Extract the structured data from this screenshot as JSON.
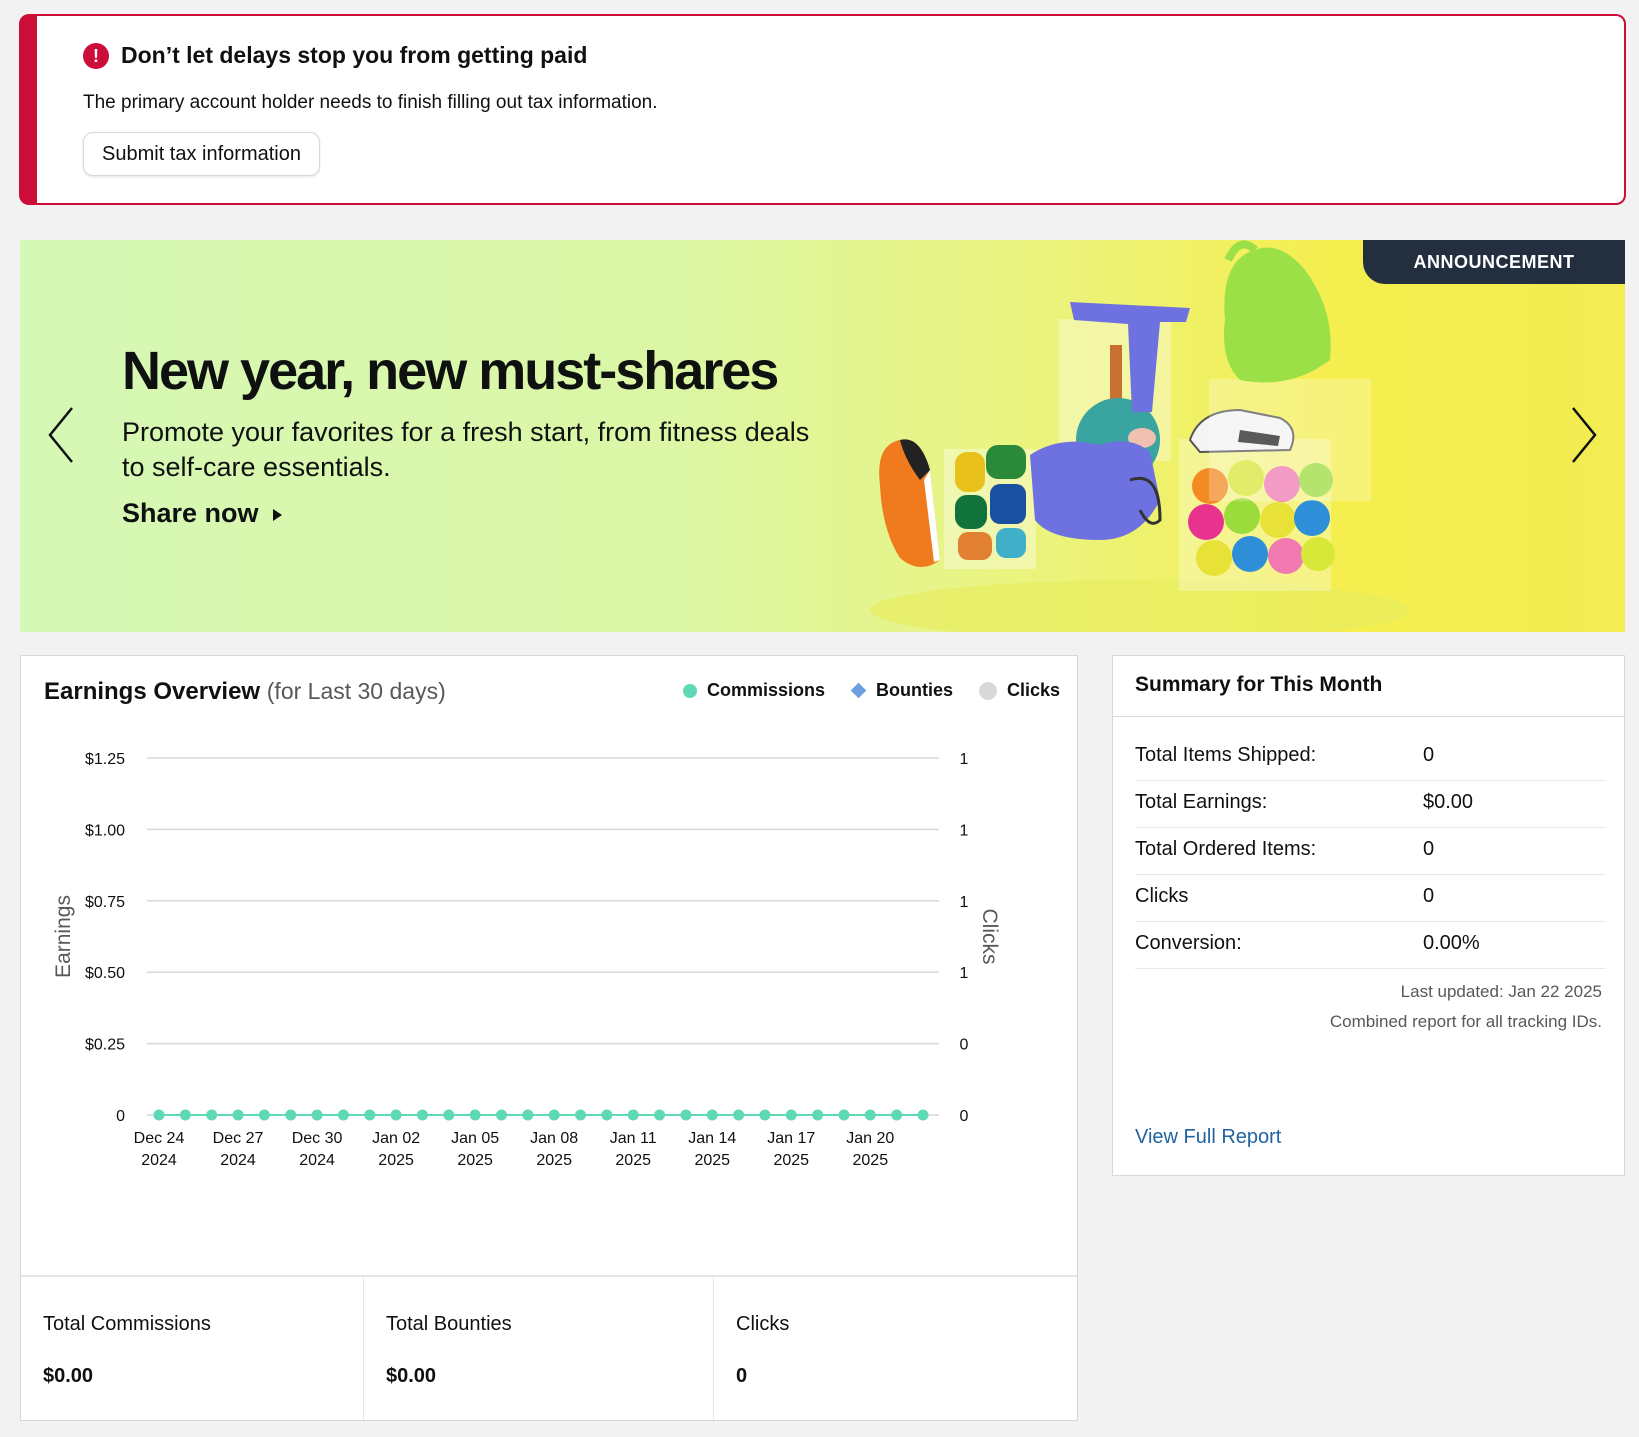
{
  "alert": {
    "title": "Don’t let delays stop you from getting paid",
    "message": "The primary account holder needs to finish filling out tax information.",
    "button": "Submit tax information",
    "icon": "exclamation-icon",
    "icon_glyph": "!",
    "color": "#cc0c39"
  },
  "banner": {
    "badge": "ANNOUNCEMENT",
    "title": "New year, new must-shares",
    "subtitle": "Promote your favorites for a fresh start, from fitness deals to self-care essentials.",
    "cta": "Share now",
    "cta_icon": "caret-right-icon",
    "prev_icon": "chevron-left-icon",
    "next_icon": "chevron-right-icon"
  },
  "earnings": {
    "title": "Earnings Overview",
    "subtitle": "(for Last 30 days)",
    "legend": [
      {
        "name": "Commissions",
        "color": "#5ed8b5",
        "marker": "circle"
      },
      {
        "name": "Bounties",
        "color": "#6a9fe0",
        "marker": "diamond"
      },
      {
        "name": "Clicks",
        "color": "#d9d9d9",
        "marker": "circle"
      }
    ],
    "totals": [
      {
        "label": "Total Commissions",
        "value": "$0.00"
      },
      {
        "label": "Total Bounties",
        "value": "$0.00"
      },
      {
        "label": "Clicks",
        "value": "0"
      }
    ]
  },
  "chart_data": {
    "type": "line",
    "title": "Earnings Overview",
    "ylabel": "Earnings",
    "y2label": "Clicks",
    "ylim": [
      0,
      1.25
    ],
    "yticks": [
      "$1.25",
      "$1.00",
      "$0.75",
      "$0.50",
      "$0.25",
      "0"
    ],
    "y2ticks": [
      "1",
      "1",
      "1",
      "1",
      "0",
      "0"
    ],
    "xticks": [
      [
        "Dec 24",
        "2024"
      ],
      [
        "Dec 27",
        "2024"
      ],
      [
        "Dec 30",
        "2024"
      ],
      [
        "Jan 02",
        "2025"
      ],
      [
        "Jan 05",
        "2025"
      ],
      [
        "Jan 08",
        "2025"
      ],
      [
        "Jan 11",
        "2025"
      ],
      [
        "Jan 14",
        "2025"
      ],
      [
        "Jan 17",
        "2025"
      ],
      [
        "Jan 20",
        "2025"
      ]
    ],
    "x": [
      "2024-12-24",
      "2024-12-25",
      "2024-12-26",
      "2024-12-27",
      "2024-12-28",
      "2024-12-29",
      "2024-12-30",
      "2024-12-31",
      "2025-01-01",
      "2025-01-02",
      "2025-01-03",
      "2025-01-04",
      "2025-01-05",
      "2025-01-06",
      "2025-01-07",
      "2025-01-08",
      "2025-01-09",
      "2025-01-10",
      "2025-01-11",
      "2025-01-12",
      "2025-01-13",
      "2025-01-14",
      "2025-01-15",
      "2025-01-16",
      "2025-01-17",
      "2025-01-18",
      "2025-01-19",
      "2025-01-20",
      "2025-01-21",
      "2025-01-22"
    ],
    "series": [
      {
        "name": "Commissions",
        "color": "#5ed8b5",
        "values": [
          0,
          0,
          0,
          0,
          0,
          0,
          0,
          0,
          0,
          0,
          0,
          0,
          0,
          0,
          0,
          0,
          0,
          0,
          0,
          0,
          0,
          0,
          0,
          0,
          0,
          0,
          0,
          0,
          0,
          0
        ]
      }
    ],
    "legend": "top-right",
    "grid": true
  },
  "summary": {
    "title": "Summary for This Month",
    "rows": [
      {
        "label": "Total Items Shipped:",
        "value": "0"
      },
      {
        "label": "Total Earnings:",
        "value": "$0.00"
      },
      {
        "label": "Total Ordered Items:",
        "value": "0"
      },
      {
        "label": "Clicks",
        "value": "0"
      },
      {
        "label": "Conversion:",
        "value": "0.00%"
      }
    ],
    "last_updated": "Last updated: Jan 22 2025",
    "combined_note": "Combined report for all tracking IDs.",
    "link": "View Full Report",
    "link_color": "#2162a1"
  }
}
